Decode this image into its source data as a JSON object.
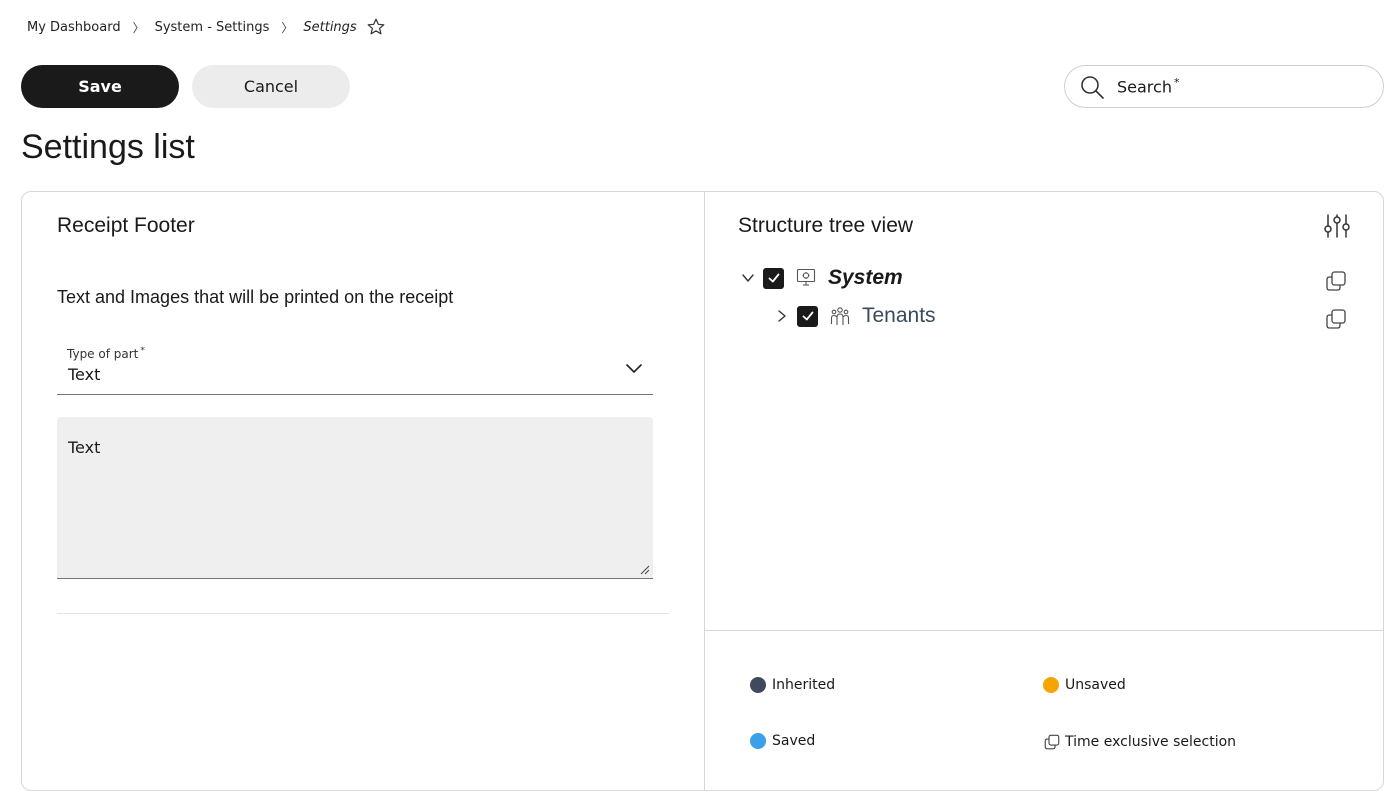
{
  "breadcrumb": {
    "items": [
      "My Dashboard",
      "System - Settings"
    ],
    "current": "Settings",
    "separator": "〉"
  },
  "toolbar": {
    "save_label": "Save",
    "cancel_label": "Cancel"
  },
  "search": {
    "placeholder": "Search",
    "required_mark": "*"
  },
  "page": {
    "title": "Settings list"
  },
  "form": {
    "section_title": "Receipt Footer",
    "description": "Text and Images that will be printed on the receipt",
    "type_of_part": {
      "label": "Type of part",
      "required_mark": "*",
      "value": "Text"
    },
    "text_area": {
      "label": "Text",
      "value": ""
    }
  },
  "tree": {
    "title": "Structure tree view",
    "nodes": [
      {
        "label": "System",
        "checked": true,
        "expanded": true,
        "icon": "monitor-icon"
      },
      {
        "label": "Tenants",
        "checked": true,
        "expanded": false,
        "icon": "people-icon"
      }
    ]
  },
  "legend": {
    "inherited": "Inherited",
    "unsaved": "Unsaved",
    "saved": "Saved",
    "time_exclusive": "Time exclusive selection"
  },
  "colors": {
    "primary": "#1a1a1a",
    "inherited": "#3f4a5e",
    "unsaved": "#f5a500",
    "saved": "#3aa0e8"
  }
}
